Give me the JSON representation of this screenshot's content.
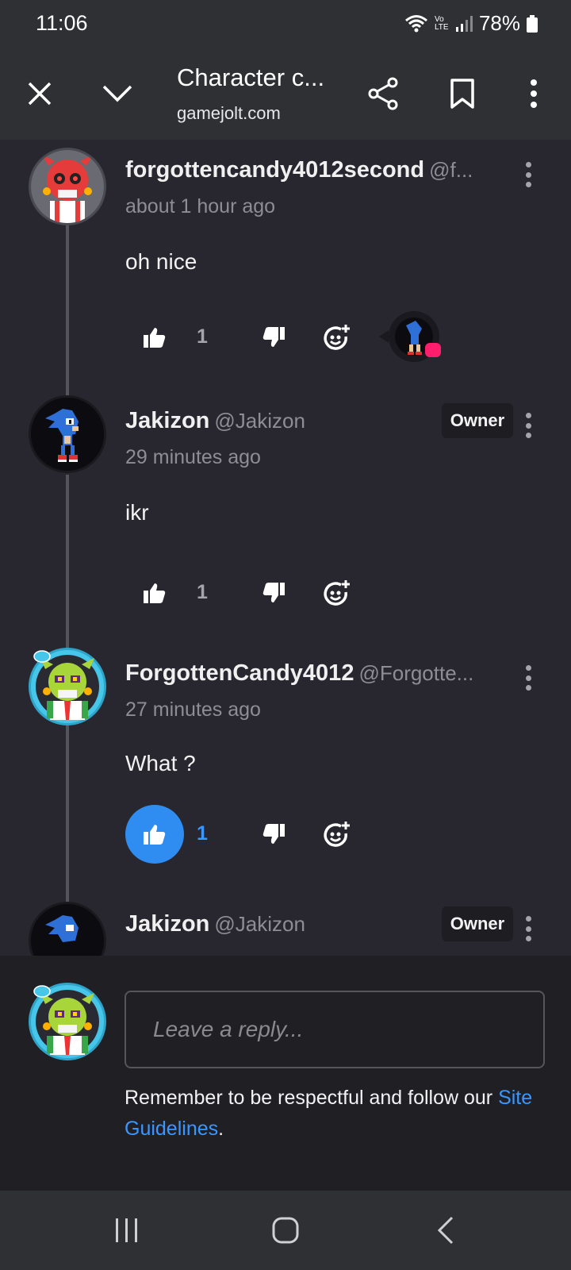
{
  "status_bar": {
    "time": "11:06",
    "battery": "78%",
    "network_label": "Vo LTE"
  },
  "browser_bar": {
    "title": "Character c...",
    "url": "gamejolt.com"
  },
  "comments": [
    {
      "author": "forgottencandy4012second",
      "handle": "@f...",
      "time": "about 1 hour ago",
      "body": "oh nice",
      "likes": "1",
      "liked": false,
      "owner": false
    },
    {
      "author": "Jakizon",
      "handle": "@Jakizon",
      "time": "29 minutes ago",
      "body": "ikr",
      "likes": "1",
      "liked": false,
      "owner": true,
      "badge": "Owner"
    },
    {
      "author": "ForgottenCandy4012",
      "handle": "@Forgotte...",
      "time": "27 minutes ago",
      "body": "What ?",
      "likes": "1",
      "liked": true,
      "owner": false
    },
    {
      "author": "Jakizon",
      "handle": "@Jakizon",
      "badge": "Owner",
      "owner": true
    }
  ],
  "reply": {
    "placeholder": "Leave a reply...",
    "notice_prefix": "Remember to be respectful and follow our",
    "link_label": "Site Guidelines",
    "notice_suffix": "."
  },
  "colors": {
    "accent": "#2f8cf0",
    "background": "#28272f",
    "panel": "#201f24",
    "bar": "#2f3033",
    "reaction_dot": "#ff1e6c"
  },
  "icons": [
    "close-icon",
    "chevron-down-icon",
    "share-icon",
    "bookmark-icon",
    "more-vert-icon",
    "thumb-up-icon",
    "thumb-down-icon",
    "add-reaction-icon",
    "recent-apps-icon",
    "home-icon",
    "back-icon"
  ]
}
